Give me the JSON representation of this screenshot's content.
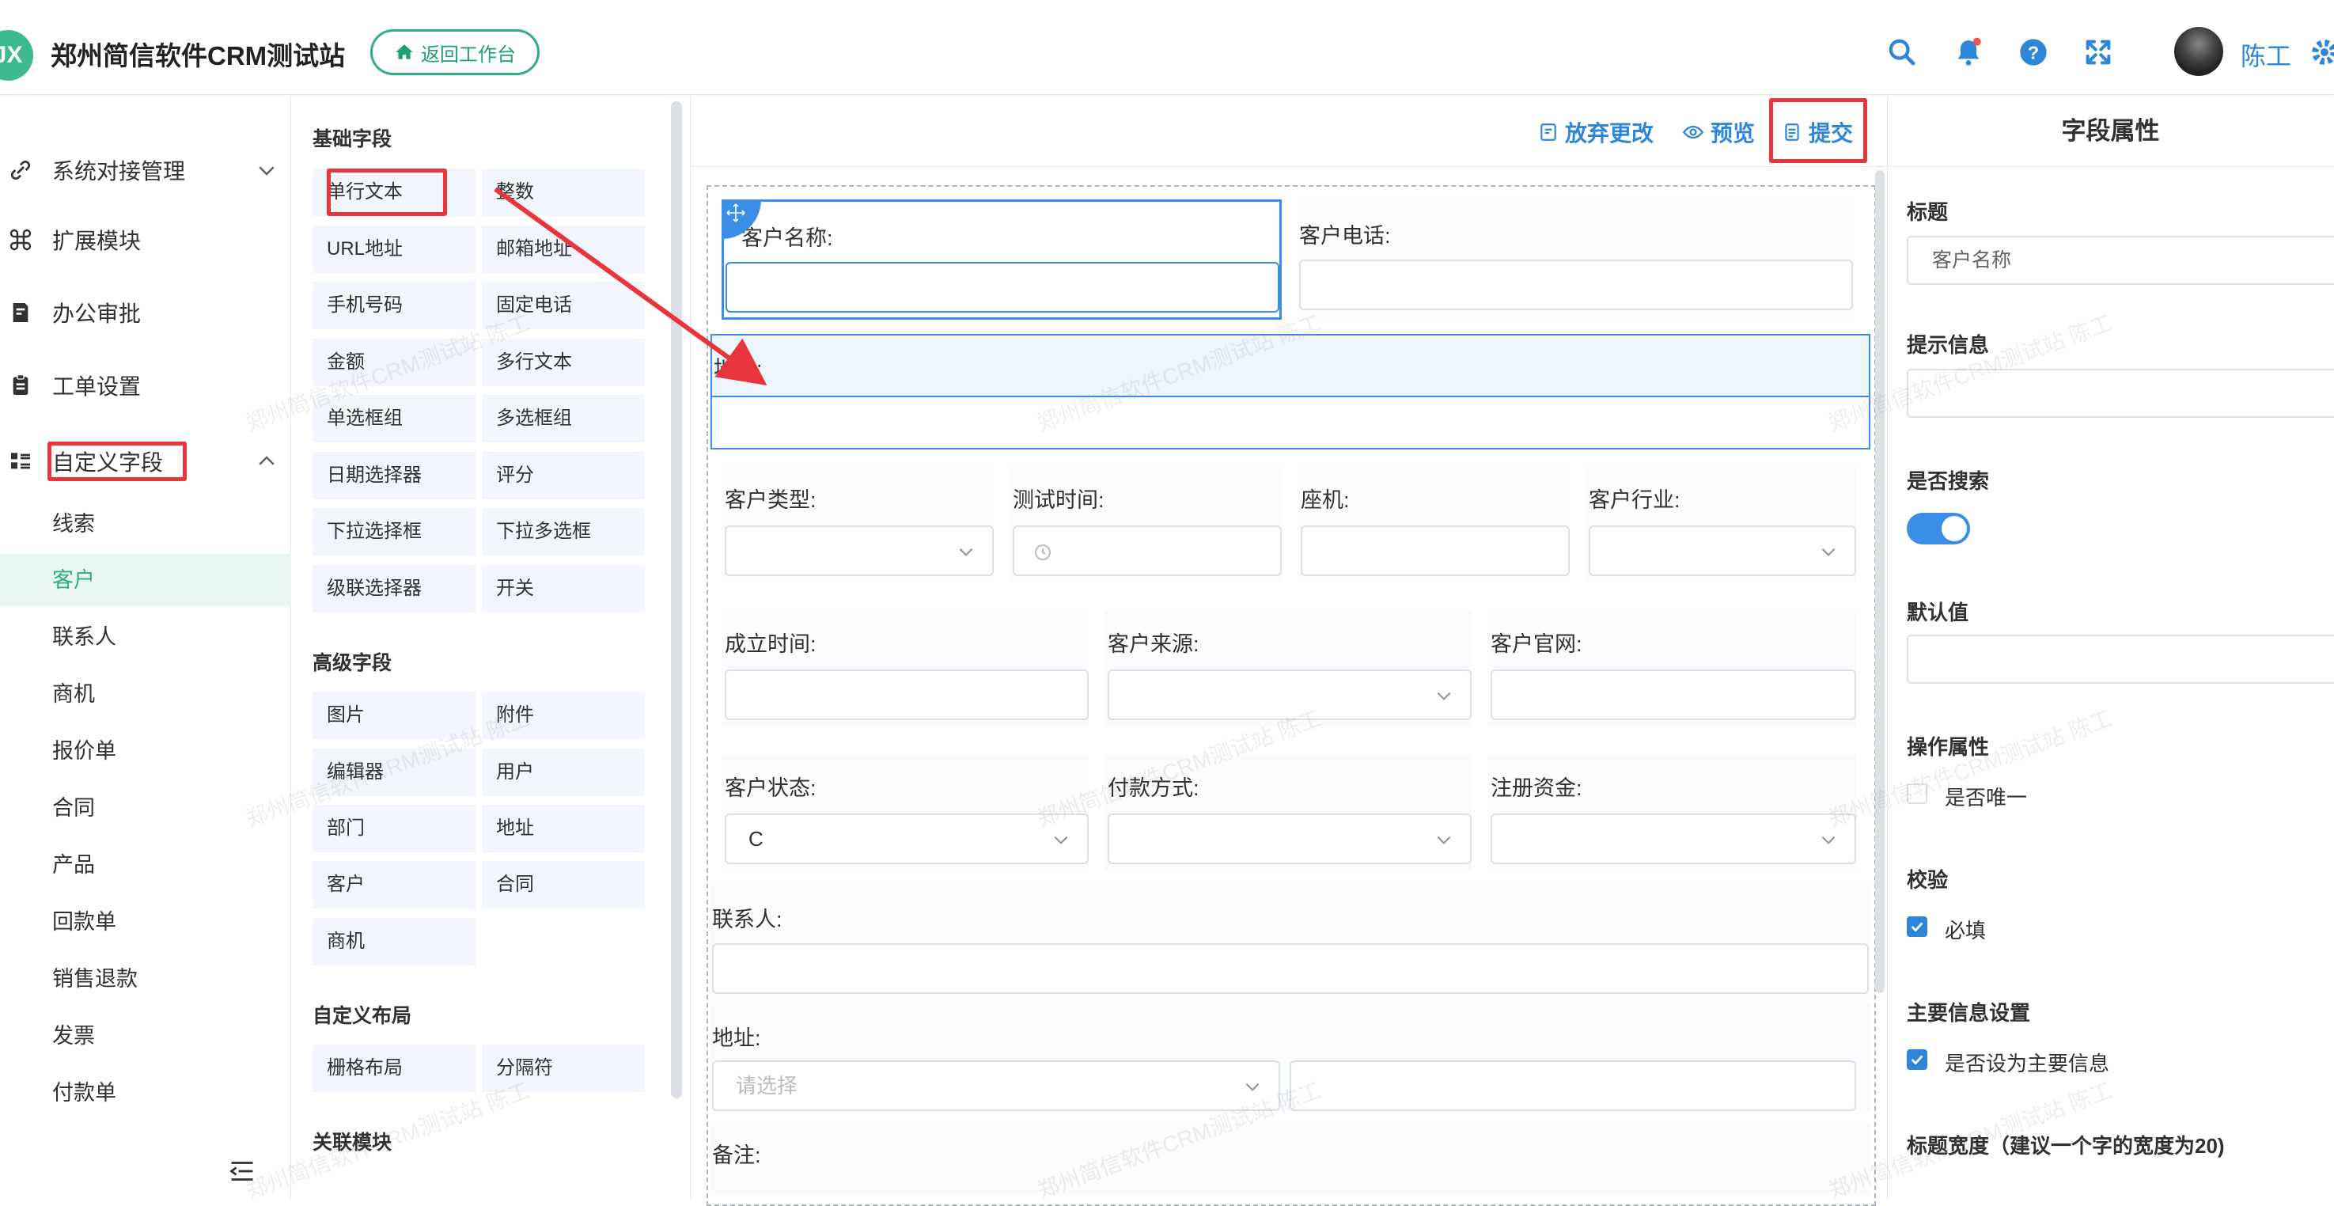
{
  "header": {
    "logo_text": "JX",
    "title": "郑州简信软件CRM测试站",
    "back_label": "返回工作台",
    "user_name": "陈工",
    "icons": [
      "search-icon",
      "bell-icon",
      "help-icon",
      "fullscreen-icon",
      "gear-icon"
    ]
  },
  "sidebar": {
    "top_items": [
      {
        "label": "系统对接管理",
        "icon": "link-icon"
      },
      {
        "label": "扩展模块",
        "icon": "command-icon"
      },
      {
        "label": "办公审批",
        "icon": "approval-icon"
      },
      {
        "label": "工单设置",
        "icon": "clipboard-icon"
      },
      {
        "label": "自定义字段",
        "icon": "grid-list-icon"
      }
    ],
    "sub_items": [
      "线索",
      "客户",
      "联系人",
      "商机",
      "报价单",
      "合同",
      "产品",
      "回款单",
      "销售退款",
      "发票",
      "付款单"
    ],
    "active_sub": "客户"
  },
  "palette": {
    "basic_title": "基础字段",
    "basic_fields": [
      "单行文本",
      "整数",
      "URL地址",
      "邮箱地址",
      "手机号码",
      "固定电话",
      "金额",
      "多行文本",
      "单选框组",
      "多选框组",
      "日期选择器",
      "评分",
      "下拉选择框",
      "下拉多选框",
      "级联选择器",
      "开关"
    ],
    "advanced_title": "高级字段",
    "advanced_fields": [
      "图片",
      "附件",
      "编辑器",
      "用户",
      "部门",
      "地址",
      "客户",
      "合同",
      "商机"
    ],
    "layout_title": "自定义布局",
    "layout_fields": [
      "栅格布局",
      "分隔符"
    ],
    "relation_title": "关联模块"
  },
  "toolbar": {
    "discard_label": "放弃更改",
    "preview_label": "预览",
    "submit_label": "提交"
  },
  "form": {
    "customer_name": "客户名称:",
    "customer_phone": "客户电话:",
    "address_drop": "地址:",
    "customer_type": "客户类型:",
    "test_time": "测试时间:",
    "landline": "座机:",
    "industry": "客户行业:",
    "founded": "成立时间:",
    "source": "客户来源:",
    "website": "客户官网:",
    "status": "客户状态:",
    "status_value": "C",
    "payment": "付款方式:",
    "capital": "注册资金:",
    "contact": "联系人:",
    "address": "地址:",
    "address_placeholder": "请选择",
    "remark": "备注:"
  },
  "props": {
    "title": "字段属性",
    "label_title": "标题",
    "label_value": "客户名称",
    "hint_title": "提示信息",
    "search_title": "是否搜索",
    "search_on": true,
    "default_title": "默认值",
    "op_title": "操作属性",
    "unique_label": "是否唯一",
    "unique_checked": false,
    "validate_title": "校验",
    "required_label": "必填",
    "required_checked": true,
    "main_title": "主要信息设置",
    "main_label": "是否设为主要信息",
    "main_checked": true,
    "width_title": "标题宽度（建议一个字的宽度为20)"
  },
  "watermark": "郑州简信软件CRM测试站 陈工",
  "colors": {
    "accent_green": "#2fae86",
    "accent_blue": "#2d86d8",
    "highlight_red": "#e8343a"
  }
}
